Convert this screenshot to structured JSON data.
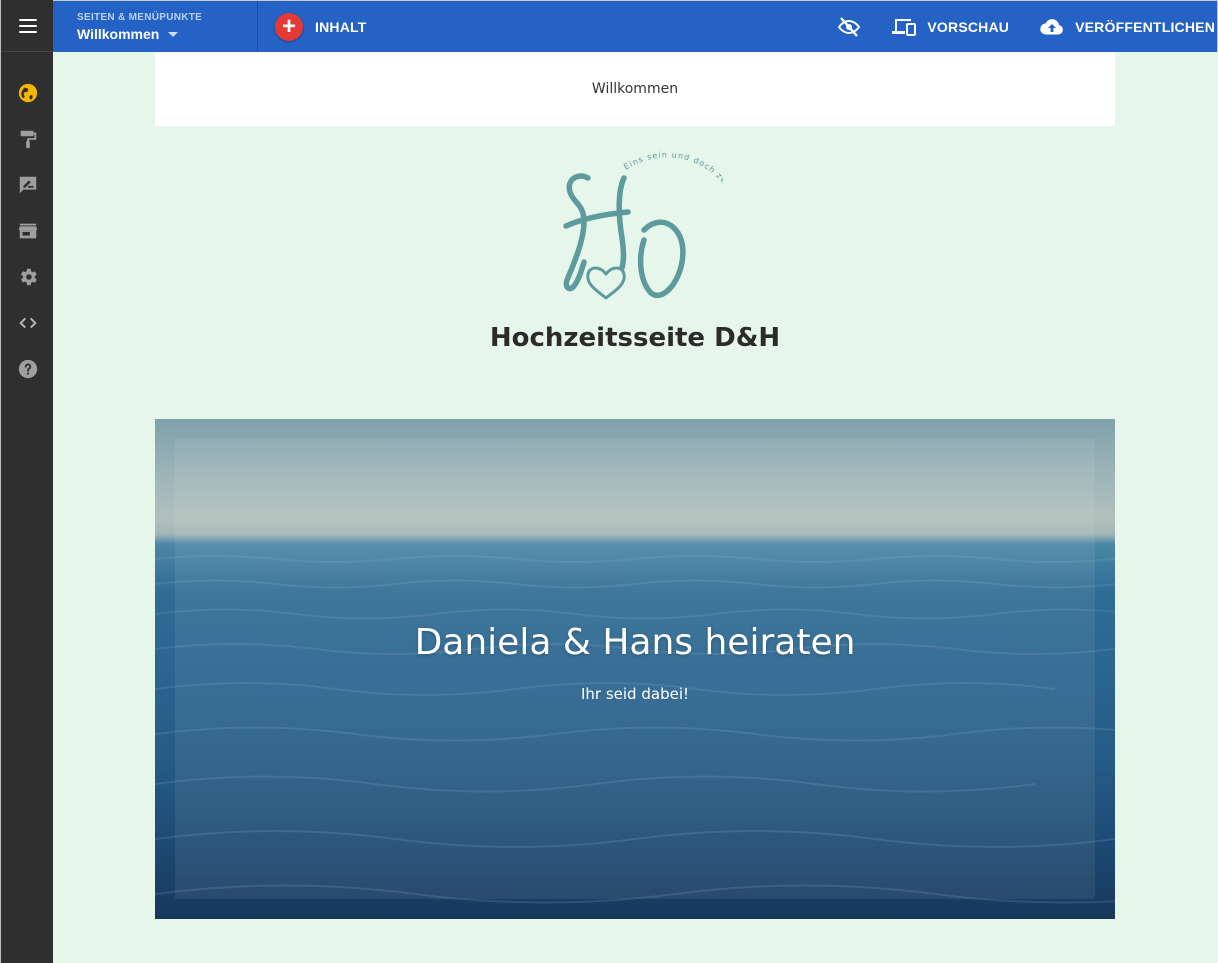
{
  "editor": {
    "page_selector": {
      "kicker": "SEITEN & MENÜPUNKTE",
      "current_page": "Willkommen"
    },
    "add_content_label": "INHALT",
    "actions": {
      "preview_label": "VORSCHAU",
      "publish_label": "VERÖFFENTLICHEN"
    },
    "sidebar_icons": [
      "globe-icon",
      "paint-roller-icon",
      "feedback-icon",
      "store-icon",
      "settings-icon",
      "code-icon",
      "help-icon"
    ],
    "colors": {
      "topbar": "#2562c6",
      "sidebar": "#2f2f2f",
      "globe_accent": "#f5b400",
      "add_button": "#e53935"
    }
  },
  "site": {
    "nav": [
      "Willkommen"
    ],
    "logo": {
      "monogram": "HD",
      "motto": "Eins sein und doch zwei bleiben"
    },
    "title": "Hochzeitsseite D&H",
    "hero": {
      "heading": "Daniela & Hans heiraten",
      "subheading": "Ihr seid dabei!"
    },
    "colors": {
      "background": "#e6f6ea",
      "logo": "#5e9b9e"
    }
  }
}
